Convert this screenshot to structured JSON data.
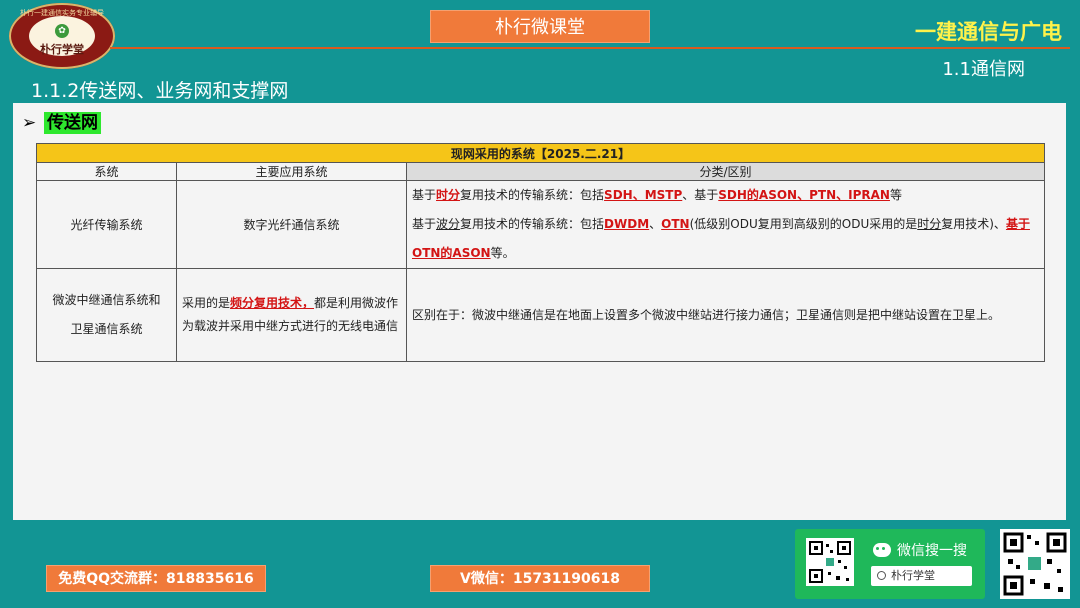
{
  "logo": {
    "arc_text": "朴行一建通信实务专业辅导",
    "name": "朴行学堂"
  },
  "header": {
    "brand": "朴行微课堂",
    "course_title": "一建通信与广电",
    "section": "1.1通信网"
  },
  "page_title": "1.1.2传送网、业务网和支撑网",
  "bullet": {
    "arrow": "➢",
    "heading": "传送网"
  },
  "table": {
    "caption": "现网采用的系统【2025.二.21】",
    "headers": [
      "系统",
      "主要应用系统",
      "分类/区别"
    ],
    "rows": [
      {
        "system": "光纤传输系统",
        "application": "数字光纤通信系统",
        "detail": {
          "p1": [
            "基于",
            "时分",
            "复用技术的传输系统：包括",
            "SDH、MSTP",
            "、基于",
            "SDH的ASON、PTN、IPRAN",
            "等"
          ],
          "p2": [
            "基于",
            "波分",
            "复用技术的传输系统：包括",
            "DWDM",
            "、",
            "OTN",
            "(低级别ODU复用到高级别的ODU采用的是",
            "时分",
            "复用技术)、",
            "基于OTN的ASON",
            "等。"
          ]
        }
      },
      {
        "system_line1": "微波中继通信系统和",
        "system_line2": "卫星通信系统",
        "application": [
          "采用的是",
          "频分复用技术，",
          "都是利用微波作为载波并采用中继方式进行的无线电通信"
        ],
        "detail": "区别在于：微波中继通信是在地面上设置多个微波中继站进行接力通信；卫星通信则是把中继站设置在卫星上。"
      }
    ]
  },
  "footer": {
    "qq_group": "免费QQ交流群：818835616",
    "wechat_id": "V微信：15731190618",
    "wechat_search_label": "微信搜一搜",
    "search_value": "朴行学堂"
  },
  "colors": {
    "background": "#129594",
    "accent_orange": "#f07a3a",
    "highlight_yellow": "#f5c518",
    "heading_green": "#2ee82e",
    "emphasis_red": "#d31414"
  }
}
